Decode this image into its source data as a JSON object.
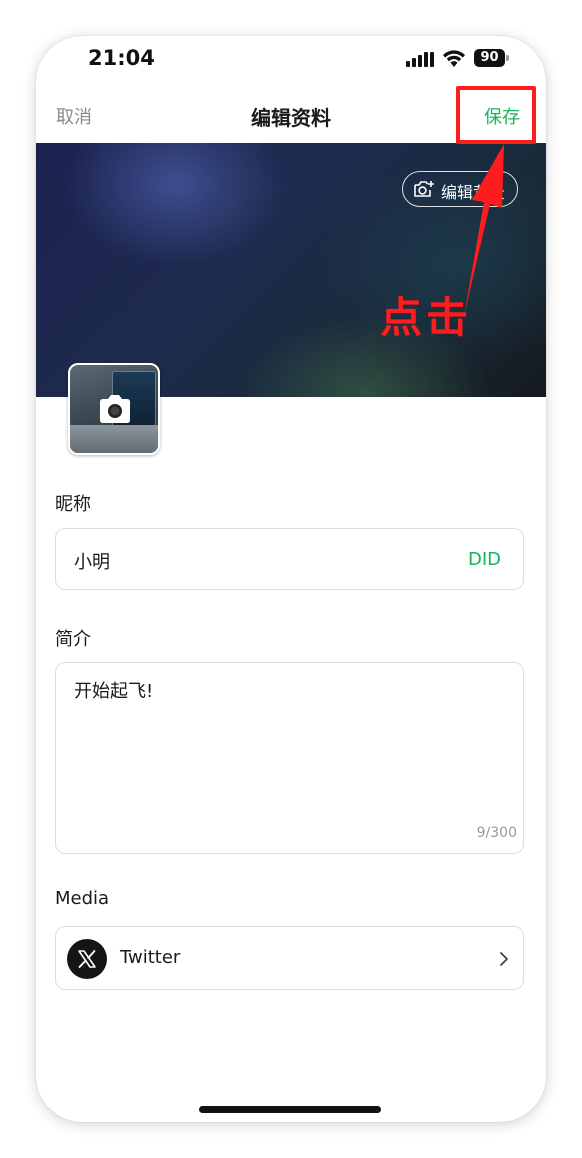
{
  "status_bar": {
    "time": "21:04",
    "battery_level": "90",
    "icons": [
      "signal-icon",
      "wifi-icon",
      "battery-icon"
    ]
  },
  "nav": {
    "cancel_label": "取消",
    "title": "编辑资料",
    "save_label": "保存"
  },
  "banner": {
    "edit_background_label": "编辑背景",
    "edit_background_icon": "camera-icon"
  },
  "annotation": {
    "text": "点击",
    "color": "#ff1c1c"
  },
  "avatar": {
    "icon": "camera-icon"
  },
  "nickname": {
    "label": "昵称",
    "value": "小明",
    "action_label": "DID"
  },
  "bio": {
    "label": "简介",
    "value": "开始起飞!",
    "counter": "9/300"
  },
  "media": {
    "label": "Media",
    "items": [
      {
        "name": "Twitter",
        "icon": "x-logo-icon"
      }
    ]
  },
  "colors": {
    "accent": "#19b35a",
    "muted": "#8a8a8a",
    "highlight": "#ff1c1c"
  }
}
